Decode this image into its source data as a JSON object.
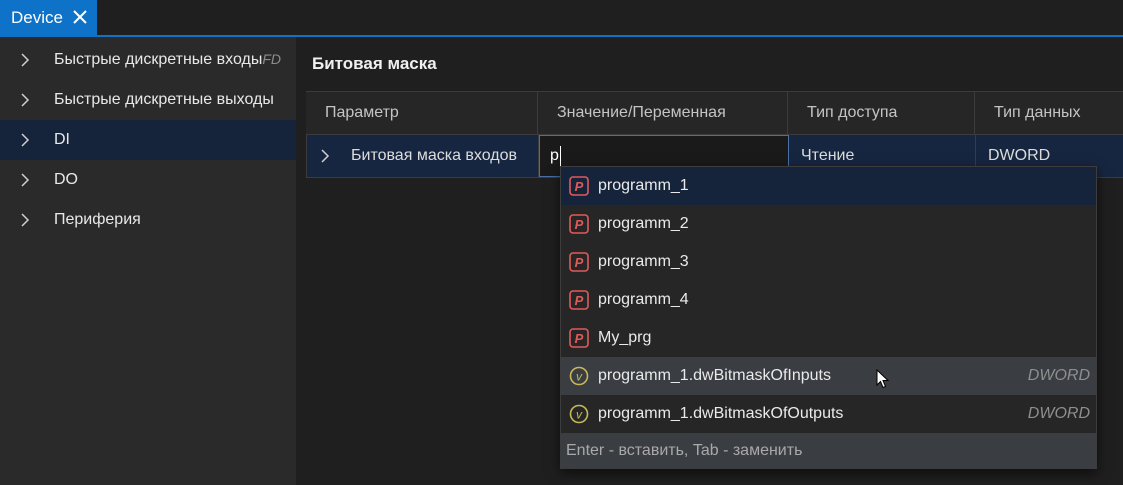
{
  "tab": {
    "title": "Device"
  },
  "sidebar": {
    "items": [
      {
        "label": "Быстрые дискретные входы",
        "suffix": "FD"
      },
      {
        "label": "Быстрые дискретные выходы"
      },
      {
        "label": "DI"
      },
      {
        "label": "DO"
      },
      {
        "label": "Периферия"
      }
    ]
  },
  "section": {
    "title": "Битовая маска"
  },
  "table": {
    "headers": [
      "Параметр",
      "Значение/Переменная",
      "Тип доступа",
      "Тип данных"
    ],
    "row": {
      "param": "Битовая маска входов",
      "value": "p",
      "access": "Чтение",
      "dtype": "DWORD"
    }
  },
  "autocomplete": {
    "items": [
      {
        "icon": "program-icon",
        "name": "programm_1",
        "type": ""
      },
      {
        "icon": "program-icon",
        "name": "programm_2",
        "type": ""
      },
      {
        "icon": "program-icon",
        "name": "programm_3",
        "type": ""
      },
      {
        "icon": "program-icon",
        "name": "programm_4",
        "type": ""
      },
      {
        "icon": "program-icon",
        "name": "My_prg",
        "type": ""
      },
      {
        "icon": "variable-icon",
        "name": "programm_1.dwBitmaskOfInputs",
        "type": "DWORD"
      },
      {
        "icon": "variable-icon",
        "name": "programm_1.dwBitmaskOfOutputs",
        "type": "DWORD"
      }
    ],
    "hint": "Enter - вставить, Tab - заменить"
  },
  "colors": {
    "accent": "#0e73c8",
    "selection": "#16243b",
    "program_icon": "#e05a5a",
    "variable_icon": "#c9b75a"
  }
}
